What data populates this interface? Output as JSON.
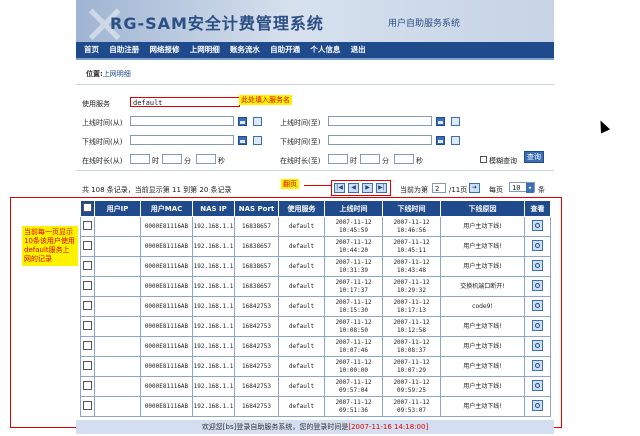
{
  "header": {
    "logo": "RG-SAM安全计费管理系统",
    "subtitle": "用户自助服务系统"
  },
  "nav": [
    "首页",
    "自助注册",
    "网络报修",
    "上网明细",
    "账务流水",
    "自助开通",
    "个人信息",
    "退出"
  ],
  "breadcrumb": {
    "prefix": "位置:",
    "page": "上网明细"
  },
  "filters": {
    "service_label": "使用服务",
    "service_value": "default",
    "service_note": "此处填入服务名",
    "online_from_label": "上线时间(从)",
    "online_to_label": "上线时间(至)",
    "offline_from_label": "下线时间(从)",
    "offline_to_label": "下线时间(至)",
    "duration_from_label": "在线时长(从)",
    "duration_to_label": "在线时长(至)",
    "hour": "时",
    "minute": "分",
    "second": "秒",
    "fuzzy_label": "模糊查询",
    "query_button": "查询"
  },
  "summary": "共 108 条记录，当前显示第 11 到第 20 条记录",
  "pager": {
    "note": "翻页",
    "current_label": "当前为第",
    "current_page": "2",
    "total": "/11页",
    "per_page_label": "每页",
    "per_page_value": "10",
    "unit": "条"
  },
  "side_note": "当前每一页显示10条该用户使用default服务上网的记录",
  "table": {
    "headers": [
      "用户IP",
      "用户MAC",
      "NAS IP",
      "NAS Port",
      "使用服务",
      "上线时间",
      "下线时间",
      "下线原因",
      "查看"
    ],
    "rows": [
      [
        "",
        "0000E81116AB",
        "192.168.1.1",
        "16838657",
        "default",
        "2007-11-12 10:45:59",
        "2007-11-12 10:46:56",
        "用户主动下线!"
      ],
      [
        "",
        "0000E81116AB",
        "192.168.1.1",
        "16838657",
        "default",
        "2007-11-12 10:44:20",
        "2007-11-12 10:45:11",
        "用户主动下线!"
      ],
      [
        "",
        "0000E81116AB",
        "192.168.1.1",
        "16838657",
        "default",
        "2007-11-12 10:31:39",
        "2007-11-12 10:43:48",
        "用户主动下线!"
      ],
      [
        "",
        "0000E81116AB",
        "192.168.1.1",
        "16838657",
        "default",
        "2007-11-12 10:17:37",
        "2007-11-12 10:29:32",
        "交换机端口断开!"
      ],
      [
        "",
        "0000E81116AB",
        "192.168.1.1",
        "16842753",
        "default",
        "2007-11-12 10:15:30",
        "2007-11-12 10:17:13",
        "code9!"
      ],
      [
        "",
        "0000E81116AB",
        "192.168.1.1",
        "16842753",
        "default",
        "2007-11-12 10:08:50",
        "2007-11-12 10:12:58",
        "用户主动下线!"
      ],
      [
        "",
        "0000E81116AB",
        "192.168.1.1",
        "16842753",
        "default",
        "2007-11-12 10:07:46",
        "2007-11-12 10:08:37",
        "用户主动下线!"
      ],
      [
        "",
        "0000E81116AB",
        "192.168.1.1",
        "16842753",
        "default",
        "2007-11-12 10:00:00",
        "2007-11-12 10:07:29",
        "用户主动下线!"
      ],
      [
        "",
        "0000E81116AB",
        "192.168.1.1",
        "16842753",
        "default",
        "2007-11-12 09:57:04",
        "2007-11-12 09:59:25",
        "用户主动下线!"
      ],
      [
        "",
        "0000E81116AB",
        "192.168.1.1",
        "16842753",
        "default",
        "2007-11-12 09:51:36",
        "2007-11-12 09:53:07",
        "用户主动下线!"
      ]
    ]
  },
  "footer": {
    "text": "欢迎您[bs]登录自助服务系统，您的登录时间是",
    "time": "[2007-11-16 14:18:00]"
  }
}
